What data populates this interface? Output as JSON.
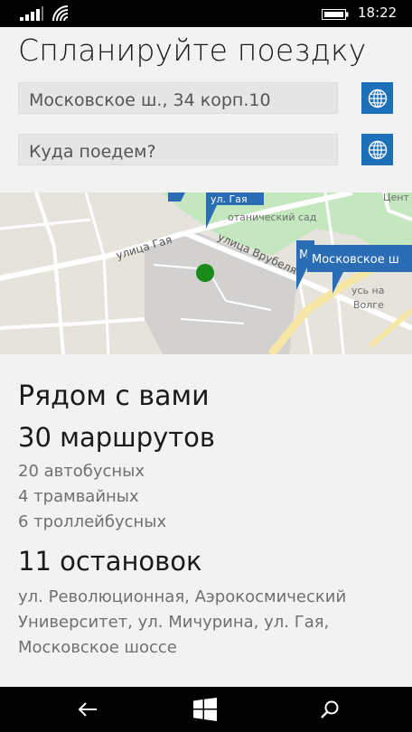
{
  "status": {
    "time": "18:22"
  },
  "header": {
    "title": "Спланируйте поездку"
  },
  "from": {
    "value": "Московское ш., 34 корп.10"
  },
  "to": {
    "placeholder": "Куда поедем?"
  },
  "map": {
    "labels": {
      "street_gaya": "улица Гая",
      "street_vrubelya": "улица Врубеля",
      "botanical": "отанический сад",
      "center": "Цент",
      "volga": "усь на",
      "volga2": "Волге",
      "pin_gaya": "ул. Гая",
      "pin_moskovskoe": "Московское ш",
      "pin_m": "М"
    },
    "colors": {
      "park": "#c5e7c0",
      "pin": "#2a6db5",
      "location": "#1a8a1a",
      "road": "#f7e7a6"
    }
  },
  "nearby": {
    "title": "Рядом с вами",
    "routes": "30 маршрутов",
    "bus": "20 автобусных",
    "tram": "4 трамвайных",
    "trolley": "6 троллейбусных",
    "stops": "11 остановок",
    "stops_list": "ул. Революционная, Аэрокосмический Университет, ул. Мичурина, ул. Гая, Московское шоссе"
  }
}
